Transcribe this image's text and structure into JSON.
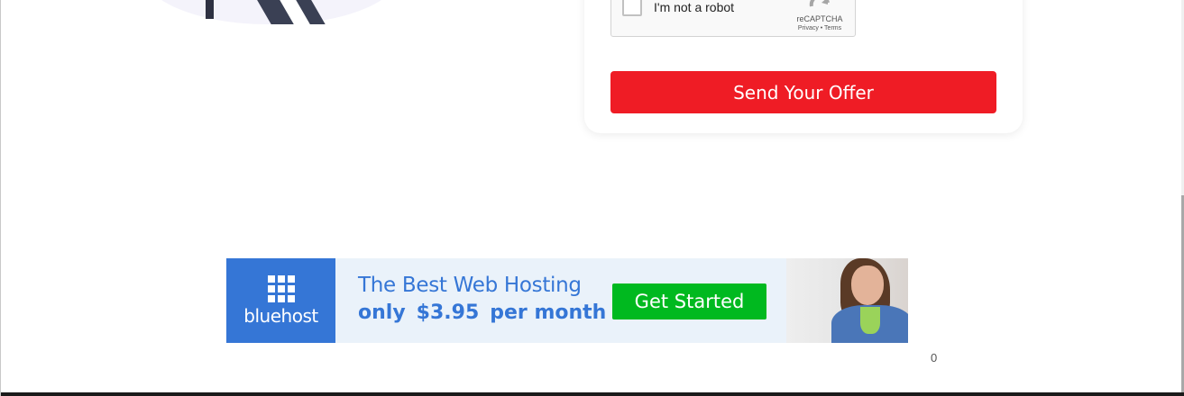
{
  "captcha": {
    "label": "I'm not a robot",
    "brand": "reCAPTCHA",
    "links": "Privacy • Terms"
  },
  "form": {
    "submit_label": "Send Your Offer"
  },
  "ad": {
    "brand": "bluehost",
    "headline": "The Best Web Hosting",
    "subline": {
      "prefix": "only",
      "price": "$3.95",
      "suffix": "per month"
    },
    "cta": "Get Started",
    "colors": {
      "brand_blue": "#3576d6",
      "cta_green": "#00b91f",
      "background": "#eaf2fa"
    }
  },
  "counter": "0",
  "colors": {
    "submit_red": "#ef1c25"
  }
}
